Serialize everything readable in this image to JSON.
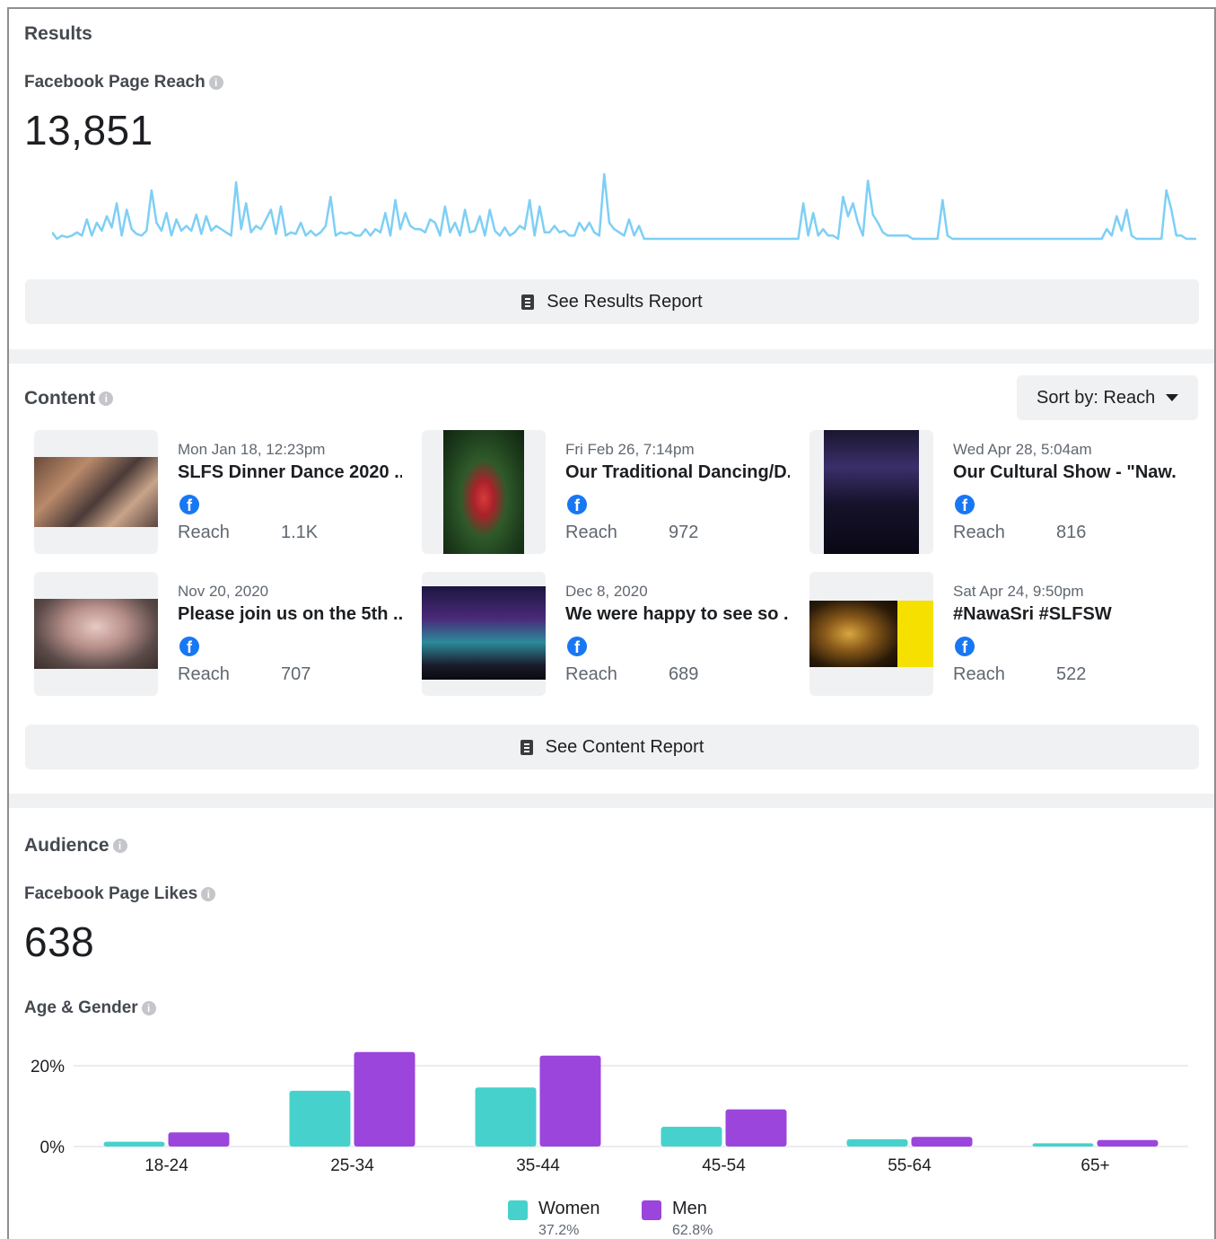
{
  "results": {
    "title": "Results",
    "metric_label": "Facebook Page Reach",
    "metric_value": "13,851",
    "report_button": "See Results Report"
  },
  "content": {
    "title": "Content",
    "sort_label": "Sort by: Reach",
    "report_button": "See Content Report",
    "posts": [
      {
        "date": "Mon Jan 18, 12:23pm",
        "title": "SLFS Dinner Dance 2020 ...",
        "reach_label": "Reach",
        "reach_value": "1.1K"
      },
      {
        "date": "Fri Feb 26, 7:14pm",
        "title": "Our Traditional Dancing/D...",
        "reach_label": "Reach",
        "reach_value": "972"
      },
      {
        "date": "Wed Apr 28, 5:04am",
        "title": "Our Cultural Show - \"Naw...",
        "reach_label": "Reach",
        "reach_value": "816"
      },
      {
        "date": "Nov 20, 2020",
        "title": "Please join us on the 5th ...",
        "reach_label": "Reach",
        "reach_value": "707"
      },
      {
        "date": "Dec 8, 2020",
        "title": "We were happy to see so ...",
        "reach_label": "Reach",
        "reach_value": "689"
      },
      {
        "date": "Sat Apr 24, 9:50pm",
        "title": "#NawaSri #SLFSW",
        "reach_label": "Reach",
        "reach_value": "522"
      }
    ]
  },
  "audience": {
    "title": "Audience",
    "metric_label": "Facebook Page Likes",
    "metric_value": "638",
    "chart_title": "Age & Gender"
  },
  "colors": {
    "reach_line": "#7ecff5",
    "women": "#47d1cc",
    "men": "#9b45dc",
    "facebook": "#1877f2"
  },
  "chart_data": [
    {
      "type": "line",
      "title": "Facebook Page Reach",
      "series": [
        {
          "values": [
            14,
            10,
            12,
            11,
            12,
            14,
            12,
            22,
            12,
            20,
            15,
            24,
            17,
            32,
            12,
            28,
            16,
            13,
            12,
            15,
            40,
            20,
            15,
            26,
            12,
            22,
            15,
            18,
            15,
            25,
            13,
            24,
            15,
            18,
            16,
            14,
            12,
            45,
            16,
            32,
            14,
            18,
            16,
            22,
            28,
            13,
            30,
            12,
            14,
            13,
            20,
            12,
            15,
            12,
            14,
            18,
            36,
            12,
            14,
            13,
            14,
            12,
            12,
            16,
            12,
            16,
            14,
            26,
            12,
            34,
            16,
            26,
            18,
            16,
            16,
            14,
            22,
            20,
            12,
            30,
            14,
            20,
            12,
            28,
            14,
            15,
            24,
            12,
            28,
            15,
            12,
            17,
            12,
            14,
            18,
            16,
            34,
            12,
            30,
            14,
            14,
            18,
            14,
            15,
            12,
            12,
            20,
            15,
            20,
            14,
            12,
            50,
            20,
            16,
            14,
            12,
            22,
            12,
            18,
            10,
            10,
            10,
            10,
            10,
            10,
            10,
            10,
            10,
            10,
            10,
            10,
            10,
            10,
            10,
            10,
            10,
            10,
            10,
            10,
            10,
            10,
            10,
            10,
            10,
            10,
            10,
            10,
            10,
            10,
            10,
            10,
            32,
            12,
            26,
            12,
            16,
            12,
            12,
            10,
            36,
            24,
            32,
            20,
            12,
            46,
            25,
            20,
            14,
            12,
            12,
            12,
            12,
            12,
            10,
            10,
            10,
            10,
            10,
            10,
            34,
            12,
            10,
            10,
            10,
            10,
            10,
            10,
            10,
            10,
            10,
            10,
            10,
            10,
            10,
            10,
            10,
            10,
            10,
            10,
            10,
            10,
            10,
            10,
            10,
            10,
            10,
            10,
            10,
            10,
            10,
            10,
            10,
            16,
            12,
            24,
            15,
            28,
            12,
            10,
            10,
            10,
            10,
            10,
            10,
            40,
            28,
            12,
            12,
            10,
            10,
            10
          ]
        }
      ]
    },
    {
      "type": "bar",
      "title": "Age & Gender",
      "categories": [
        "18-24",
        "25-34",
        "35-44",
        "45-54",
        "55-64",
        "65+"
      ],
      "series": [
        {
          "name": "Women",
          "values": [
            1.2,
            13.8,
            14.6,
            4.9,
            1.8,
            0.8
          ],
          "summary": "37.2%"
        },
        {
          "name": "Men",
          "values": [
            3.5,
            23.4,
            22.5,
            9.2,
            2.4,
            1.6
          ],
          "summary": "62.8%"
        }
      ],
      "ylim": [
        0,
        20
      ],
      "yticks": [
        "0%",
        "20%"
      ],
      "grid": true,
      "legend": "bottom"
    }
  ]
}
